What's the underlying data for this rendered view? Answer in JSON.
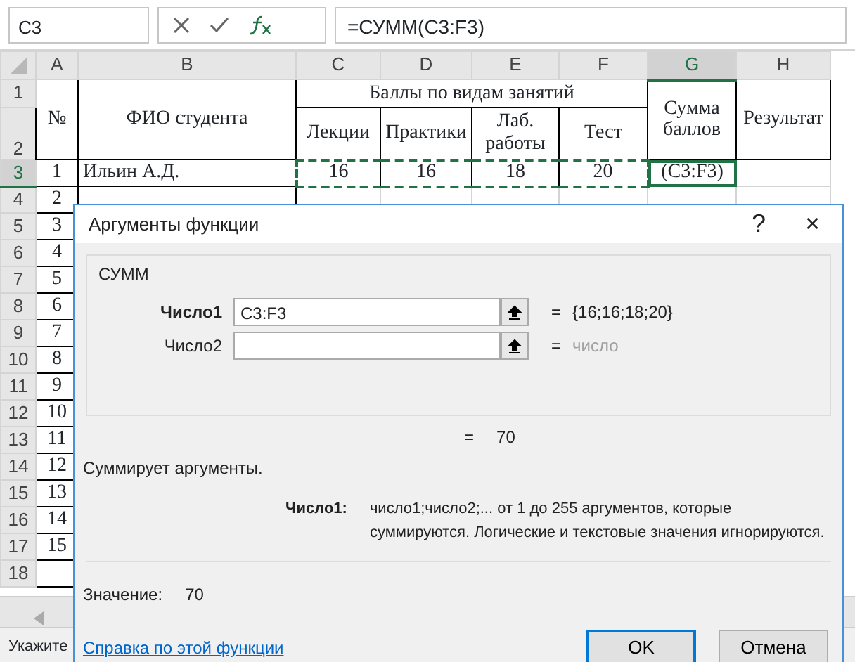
{
  "name_box": "C3",
  "formula": "=СУММ(C3:F3)",
  "columns": [
    {
      "label": "A",
      "selected": false
    },
    {
      "label": "B",
      "selected": false
    },
    {
      "label": "C",
      "selected": false
    },
    {
      "label": "D",
      "selected": false
    },
    {
      "label": "E",
      "selected": false
    },
    {
      "label": "F",
      "selected": false
    },
    {
      "label": "G",
      "selected": true
    },
    {
      "label": "H",
      "selected": false
    }
  ],
  "header": {
    "row1": "1",
    "row2": "2",
    "number": "№",
    "name": "ФИО студента",
    "group": "Баллы по видам занятий",
    "subcolumns": [
      "Лекции",
      "Практики",
      "Лаб. работы",
      "Тест"
    ],
    "sum": "Сумма баллов",
    "result": "Результат"
  },
  "rows": [
    {
      "row": "3",
      "selected": true,
      "cells": [
        "1",
        "Ильин А.Д.",
        {
          "text": "16",
          "in_range": true
        },
        {
          "text": "16",
          "in_range": true
        },
        {
          "text": "18",
          "in_range": true
        },
        {
          "text": "20",
          "in_range": true
        },
        {
          "text": "(C3:F3)",
          "active": true
        },
        ""
      ]
    },
    {
      "row": "4",
      "selected": false,
      "cells": [
        "2",
        "",
        "",
        "",
        "",
        "",
        "",
        ""
      ]
    },
    {
      "row": "5",
      "selected": false,
      "cells": [
        "3"
      ]
    },
    {
      "row": "6",
      "selected": false,
      "cells": [
        "4"
      ]
    },
    {
      "row": "7",
      "selected": false,
      "cells": [
        "5"
      ]
    },
    {
      "row": "8",
      "selected": false,
      "cells": [
        "6"
      ]
    },
    {
      "row": "9",
      "selected": false,
      "cells": [
        "7"
      ]
    },
    {
      "row": "10",
      "selected": false,
      "cells": [
        "8"
      ]
    },
    {
      "row": "11",
      "selected": false,
      "cells": [
        "9"
      ]
    },
    {
      "row": "12",
      "selected": false,
      "cells": [
        "10"
      ]
    },
    {
      "row": "13",
      "selected": false,
      "cells": [
        "11"
      ]
    },
    {
      "row": "14",
      "selected": false,
      "cells": [
        "12"
      ]
    },
    {
      "row": "15",
      "selected": false,
      "cells": [
        "13"
      ]
    },
    {
      "row": "16",
      "selected": false,
      "cells": [
        "14"
      ]
    },
    {
      "row": "17",
      "selected": false,
      "cells": [
        "15"
      ]
    },
    {
      "row": "18",
      "selected": false,
      "cells": [
        ""
      ]
    }
  ],
  "status_bar": "Укажите",
  "dialog": {
    "title": "Аргументы функции",
    "help": "?",
    "close": "×",
    "function": "СУММ",
    "arguments": [
      {
        "label": "Число1",
        "active": true,
        "value": "C3:F3",
        "equals": "=",
        "result": "{16;16;18;20}"
      },
      {
        "label": "Число2",
        "active": false,
        "equals": "=",
        "result": "число"
      }
    ],
    "total_equals": "=",
    "total": "70",
    "description": "Суммирует аргументы.",
    "arg_help_label": "Число1:",
    "arg_help": "число1;число2;... от 1 до 255 аргументов, которые суммируются. Логические и текстовые значения игнорируются.",
    "value_label": "Значение:",
    "value": "70",
    "help_link": "Справка по этой функции",
    "buttons": [
      {
        "label": "OK",
        "selected": true
      },
      {
        "label": "Отмена",
        "selected": false
      }
    ]
  }
}
